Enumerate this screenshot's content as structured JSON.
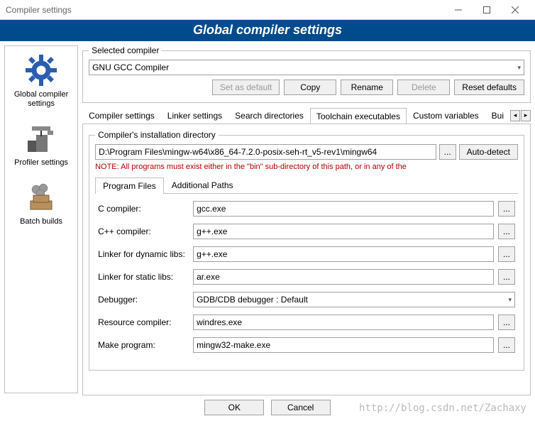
{
  "window": {
    "title": "Compiler settings"
  },
  "header": {
    "title": "Global compiler settings"
  },
  "sidebar": {
    "items": [
      {
        "label": "Global compiler settings"
      },
      {
        "label": "Profiler settings"
      },
      {
        "label": "Batch builds"
      }
    ]
  },
  "selected_compiler": {
    "legend": "Selected compiler",
    "value": "GNU GCC Compiler",
    "buttons": {
      "set_default": "Set as default",
      "copy": "Copy",
      "rename": "Rename",
      "delete": "Delete",
      "reset": "Reset defaults"
    }
  },
  "tabs": {
    "items": [
      "Compiler settings",
      "Linker settings",
      "Search directories",
      "Toolchain executables",
      "Custom variables",
      "Bui"
    ],
    "active_index": 3
  },
  "install_dir": {
    "legend": "Compiler's installation directory",
    "path": "D:\\Program Files\\mingw-w64\\x86_64-7.2.0-posix-seh-rt_v5-rev1\\mingw64",
    "browse": "...",
    "auto_detect": "Auto-detect",
    "note": "NOTE: All programs must exist either in the \"bin\" sub-directory of this path, or in any of the"
  },
  "subtabs": {
    "items": [
      "Program Files",
      "Additional Paths"
    ],
    "active_index": 0
  },
  "programs": {
    "c_compiler": {
      "label": "C compiler:",
      "value": "gcc.exe"
    },
    "cpp_compiler": {
      "label": "C++ compiler:",
      "value": "g++.exe"
    },
    "linker_dynamic": {
      "label": "Linker for dynamic libs:",
      "value": "g++.exe"
    },
    "linker_static": {
      "label": "Linker for static libs:",
      "value": "ar.exe"
    },
    "debugger": {
      "label": "Debugger:",
      "value": "GDB/CDB debugger : Default"
    },
    "resource_compiler": {
      "label": "Resource compiler:",
      "value": "windres.exe"
    },
    "make_program": {
      "label": "Make program:",
      "value": "mingw32-make.exe"
    },
    "browse": "..."
  },
  "footer": {
    "ok": "OK",
    "cancel": "Cancel"
  },
  "watermark": "http://blog.csdn.net/Zachaxy"
}
